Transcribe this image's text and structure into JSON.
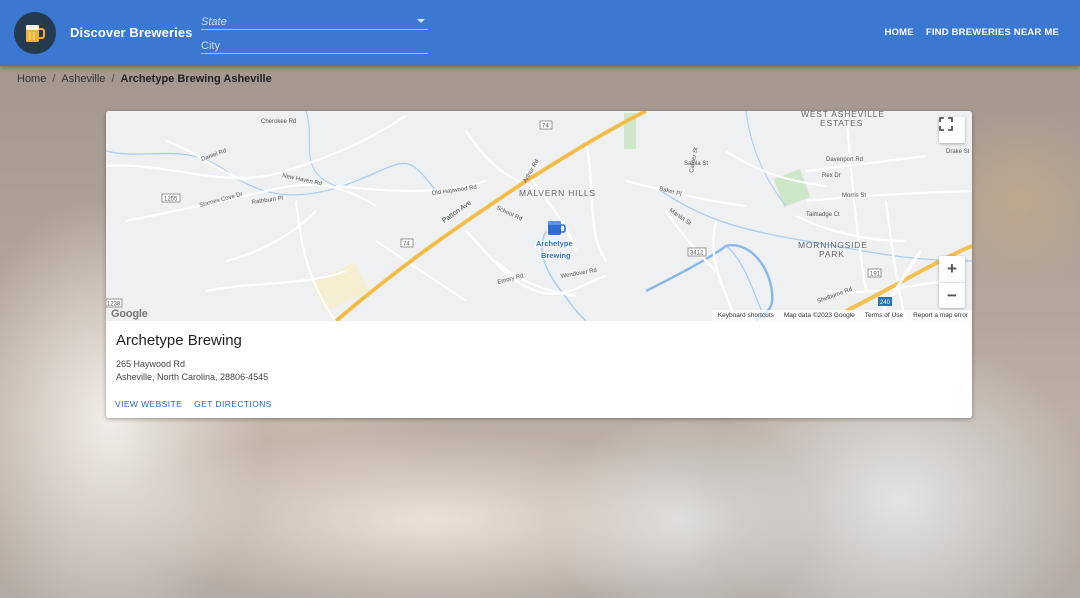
{
  "header": {
    "title": "Discover Breweries",
    "logo_icon": "beer-mug-icon",
    "state_placeholder": "State",
    "city_placeholder": "City",
    "nav": [
      {
        "label": "HOME"
      },
      {
        "label": "FIND BREWERIES NEAR ME"
      }
    ],
    "colors": {
      "appbar": "#3a78d2",
      "logo_bg": "#263a4f",
      "beer": "#f2b233"
    }
  },
  "breadcrumb": {
    "items": [
      "Home",
      "Asheville"
    ],
    "current": "Archetype Brewing Asheville",
    "separator": "/"
  },
  "map": {
    "districts": [
      "WEST ASHEVILLE",
      "ESTATES",
      "MALVERN HILLS",
      "MORNINGSIDE",
      "PARK"
    ],
    "roads": [
      "Patton Ave",
      "Cherokee Rd",
      "Daniel Rd",
      "New Haven Rd",
      "Starnes Cove Dr",
      "Rathburn Pl",
      "Old Haywood Rd",
      "Emory Rd",
      "Wendover Rd",
      "Baker Pl",
      "Manila St",
      "Davenport Rd",
      "Rex Dr",
      "Morris St",
      "Talmadge Ct",
      "Shelburne Rd",
      "School Rd",
      "Arthur Rd",
      "Drake St",
      "Salola St",
      "Carrier St"
    ],
    "route_shields": [
      "74",
      "74",
      "240",
      "191",
      "3412",
      "1255",
      "1238"
    ],
    "marker_label_line1": "Archetype",
    "marker_label_line2": "Brewing",
    "marker_icon": "brewery-pin-icon",
    "fullscreen_icon": "fullscreen-icon",
    "zoom_in": "+",
    "zoom_out": "−",
    "google_logo": "Google",
    "footer": [
      "Keyboard shortcuts",
      "Map data ©2023 Google",
      "Terms of Use",
      "Report a map error"
    ]
  },
  "brewery": {
    "name": "Archetype Brewing",
    "street": "265 Haywood Rd",
    "city_line": "Asheville, North Carolina, 28806-4545",
    "actions": [
      "VIEW WEBSITE",
      "GET DIRECTIONS"
    ]
  }
}
